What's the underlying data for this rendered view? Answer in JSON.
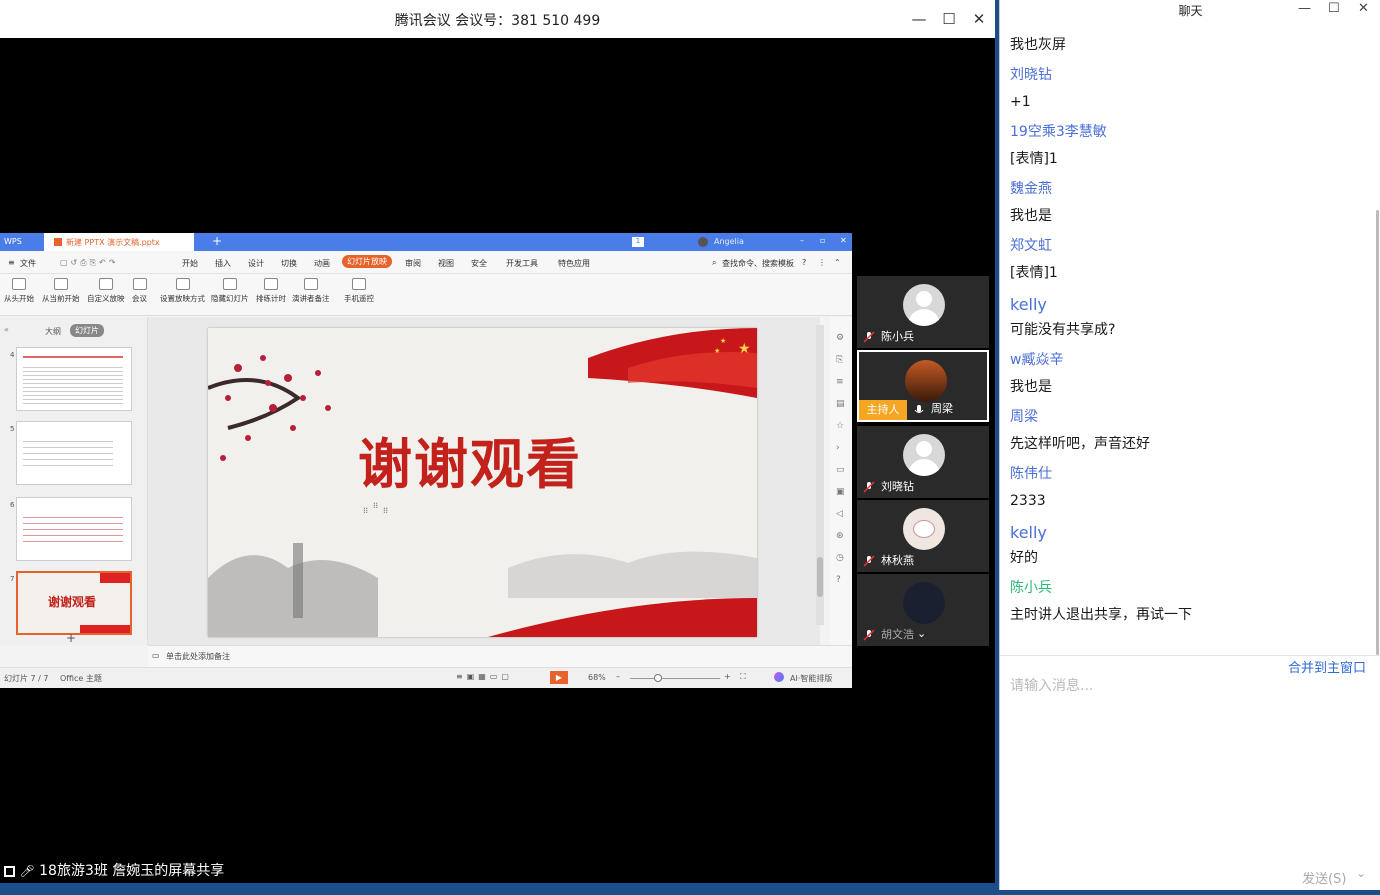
{
  "meeting": {
    "title": "腾讯会议 会议号：381 510 499",
    "share_caption": "18旅游3班 詹婉玉的屏幕共享"
  },
  "wps": {
    "app_tab": "WPS",
    "doc_tab": "新建 PPTX 演示文稿.pptx",
    "user_name": "Angelia",
    "menu": [
      "文件",
      "开始",
      "插入",
      "设计",
      "切换",
      "动画",
      "幻灯片放映",
      "审阅",
      "视图",
      "安全",
      "开发工具",
      "特色应用"
    ],
    "active_menu": "幻灯片放映",
    "search": "查找命令、搜索模板",
    "ribbon": [
      "从头开始",
      "从当前开始",
      "自定义放映",
      "会议",
      "设置放映方式",
      "隐藏幻灯片",
      "排练计时",
      "演讲者备注",
      "手机遥控"
    ],
    "pane_tabs": [
      "大纲",
      "幻灯片"
    ],
    "thumb_numbers": [
      "4",
      "5",
      "6",
      "7"
    ],
    "slide_title": "谢谢观看",
    "notes_placeholder": "单击此处添加备注",
    "status_slide": "幻灯片 7 / 7",
    "status_theme": "Office 主题",
    "zoom": "68%",
    "ai_label": "AI·智能排版"
  },
  "participants": [
    {
      "name": "陈小兵",
      "host": false
    },
    {
      "name": "周梁",
      "host": true,
      "badge": "主持人"
    },
    {
      "name": "刘晓钻",
      "host": false
    },
    {
      "name": "林秋燕",
      "host": false
    },
    {
      "name": "胡文浩",
      "host": false
    }
  ],
  "chat": {
    "title": "聊天",
    "messages": [
      {
        "text": "我也灰屏",
        "type": "msg"
      },
      {
        "text": "刘晓钻",
        "type": "sender"
      },
      {
        "text": "+1",
        "type": "msg"
      },
      {
        "text": "19空乘3李慧敏",
        "type": "sender"
      },
      {
        "text": "[表情]1",
        "type": "msg"
      },
      {
        "text": "魏金燕",
        "type": "sender"
      },
      {
        "text": "我也是",
        "type": "msg"
      },
      {
        "text": "郑文虹",
        "type": "sender"
      },
      {
        "text": "[表情]1",
        "type": "msg"
      },
      {
        "text": "kelly",
        "type": "sender"
      },
      {
        "text": "可能没有共享成?",
        "type": "msg"
      },
      {
        "text": "w臧焱辛",
        "type": "sender"
      },
      {
        "text": "我也是",
        "type": "msg"
      },
      {
        "text": "周梁",
        "type": "sender"
      },
      {
        "text": "先这样听吧，声音还好",
        "type": "msg"
      },
      {
        "text": "陈伟仕",
        "type": "sender"
      },
      {
        "text": "2333",
        "type": "msg"
      },
      {
        "text": "kelly",
        "type": "sender"
      },
      {
        "text": "好的",
        "type": "msg"
      },
      {
        "text": "陈小兵",
        "type": "sender-green"
      },
      {
        "text": "主时讲人退出共享，再试一下",
        "type": "msg"
      }
    ],
    "merge_link": "合并到主窗口",
    "input_placeholder": "请输入消息...",
    "send_label": "发送(S)"
  }
}
